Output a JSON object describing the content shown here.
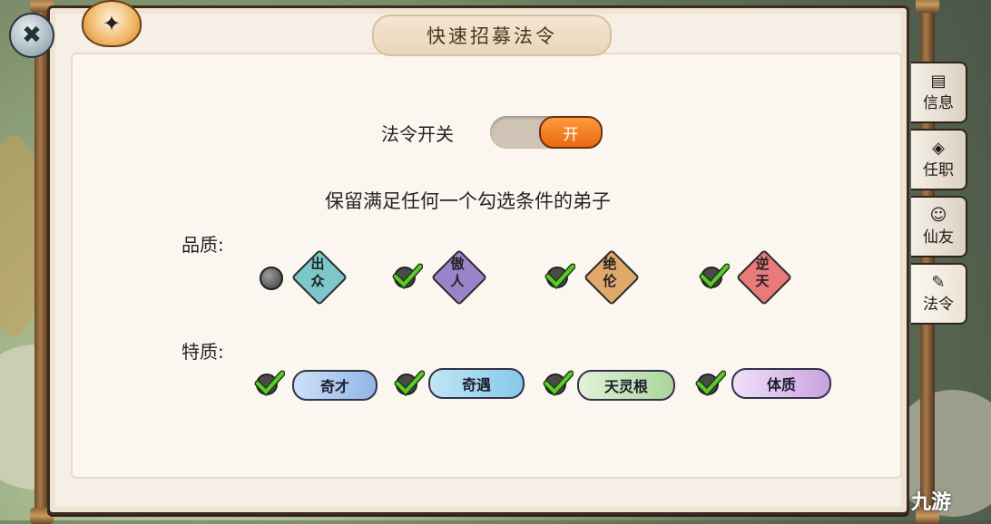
{
  "title": "快速招募法令",
  "toggle": {
    "label": "法令开关",
    "state_text": "开",
    "on": true
  },
  "instruction": "保留满足任何一个勾选条件的弟子",
  "quality": {
    "label": "品质:",
    "items": [
      {
        "text": "出众",
        "checked": false,
        "color": "#7cc7c9"
      },
      {
        "text": "傲人",
        "checked": true,
        "color": "#9b83c9"
      },
      {
        "text": "绝伦",
        "checked": true,
        "color": "#e0a86b"
      },
      {
        "text": "逆天",
        "checked": true,
        "color": "#e87a7a"
      }
    ]
  },
  "traits": {
    "label": "特质:",
    "items": [
      {
        "text": "奇才",
        "checked": true,
        "color": "#8fb6e6"
      },
      {
        "text": "奇遇",
        "checked": true,
        "color": "#86c9e8"
      },
      {
        "text": "天灵根",
        "checked": true,
        "color": "#a9d69a"
      },
      {
        "text": "体质",
        "checked": true,
        "color": "#c9a3e0"
      }
    ]
  },
  "side_tabs": [
    {
      "label": "信息",
      "icon": "info-icon"
    },
    {
      "label": "任职",
      "icon": "post-icon"
    },
    {
      "label": "仙友",
      "icon": "friend-icon"
    },
    {
      "label": "法令",
      "icon": "decree-icon"
    }
  ],
  "watermark": "九游",
  "colors": {
    "toggle_on": "#f08a2c",
    "check": "#4caf2a",
    "ink": "#2a2220"
  }
}
